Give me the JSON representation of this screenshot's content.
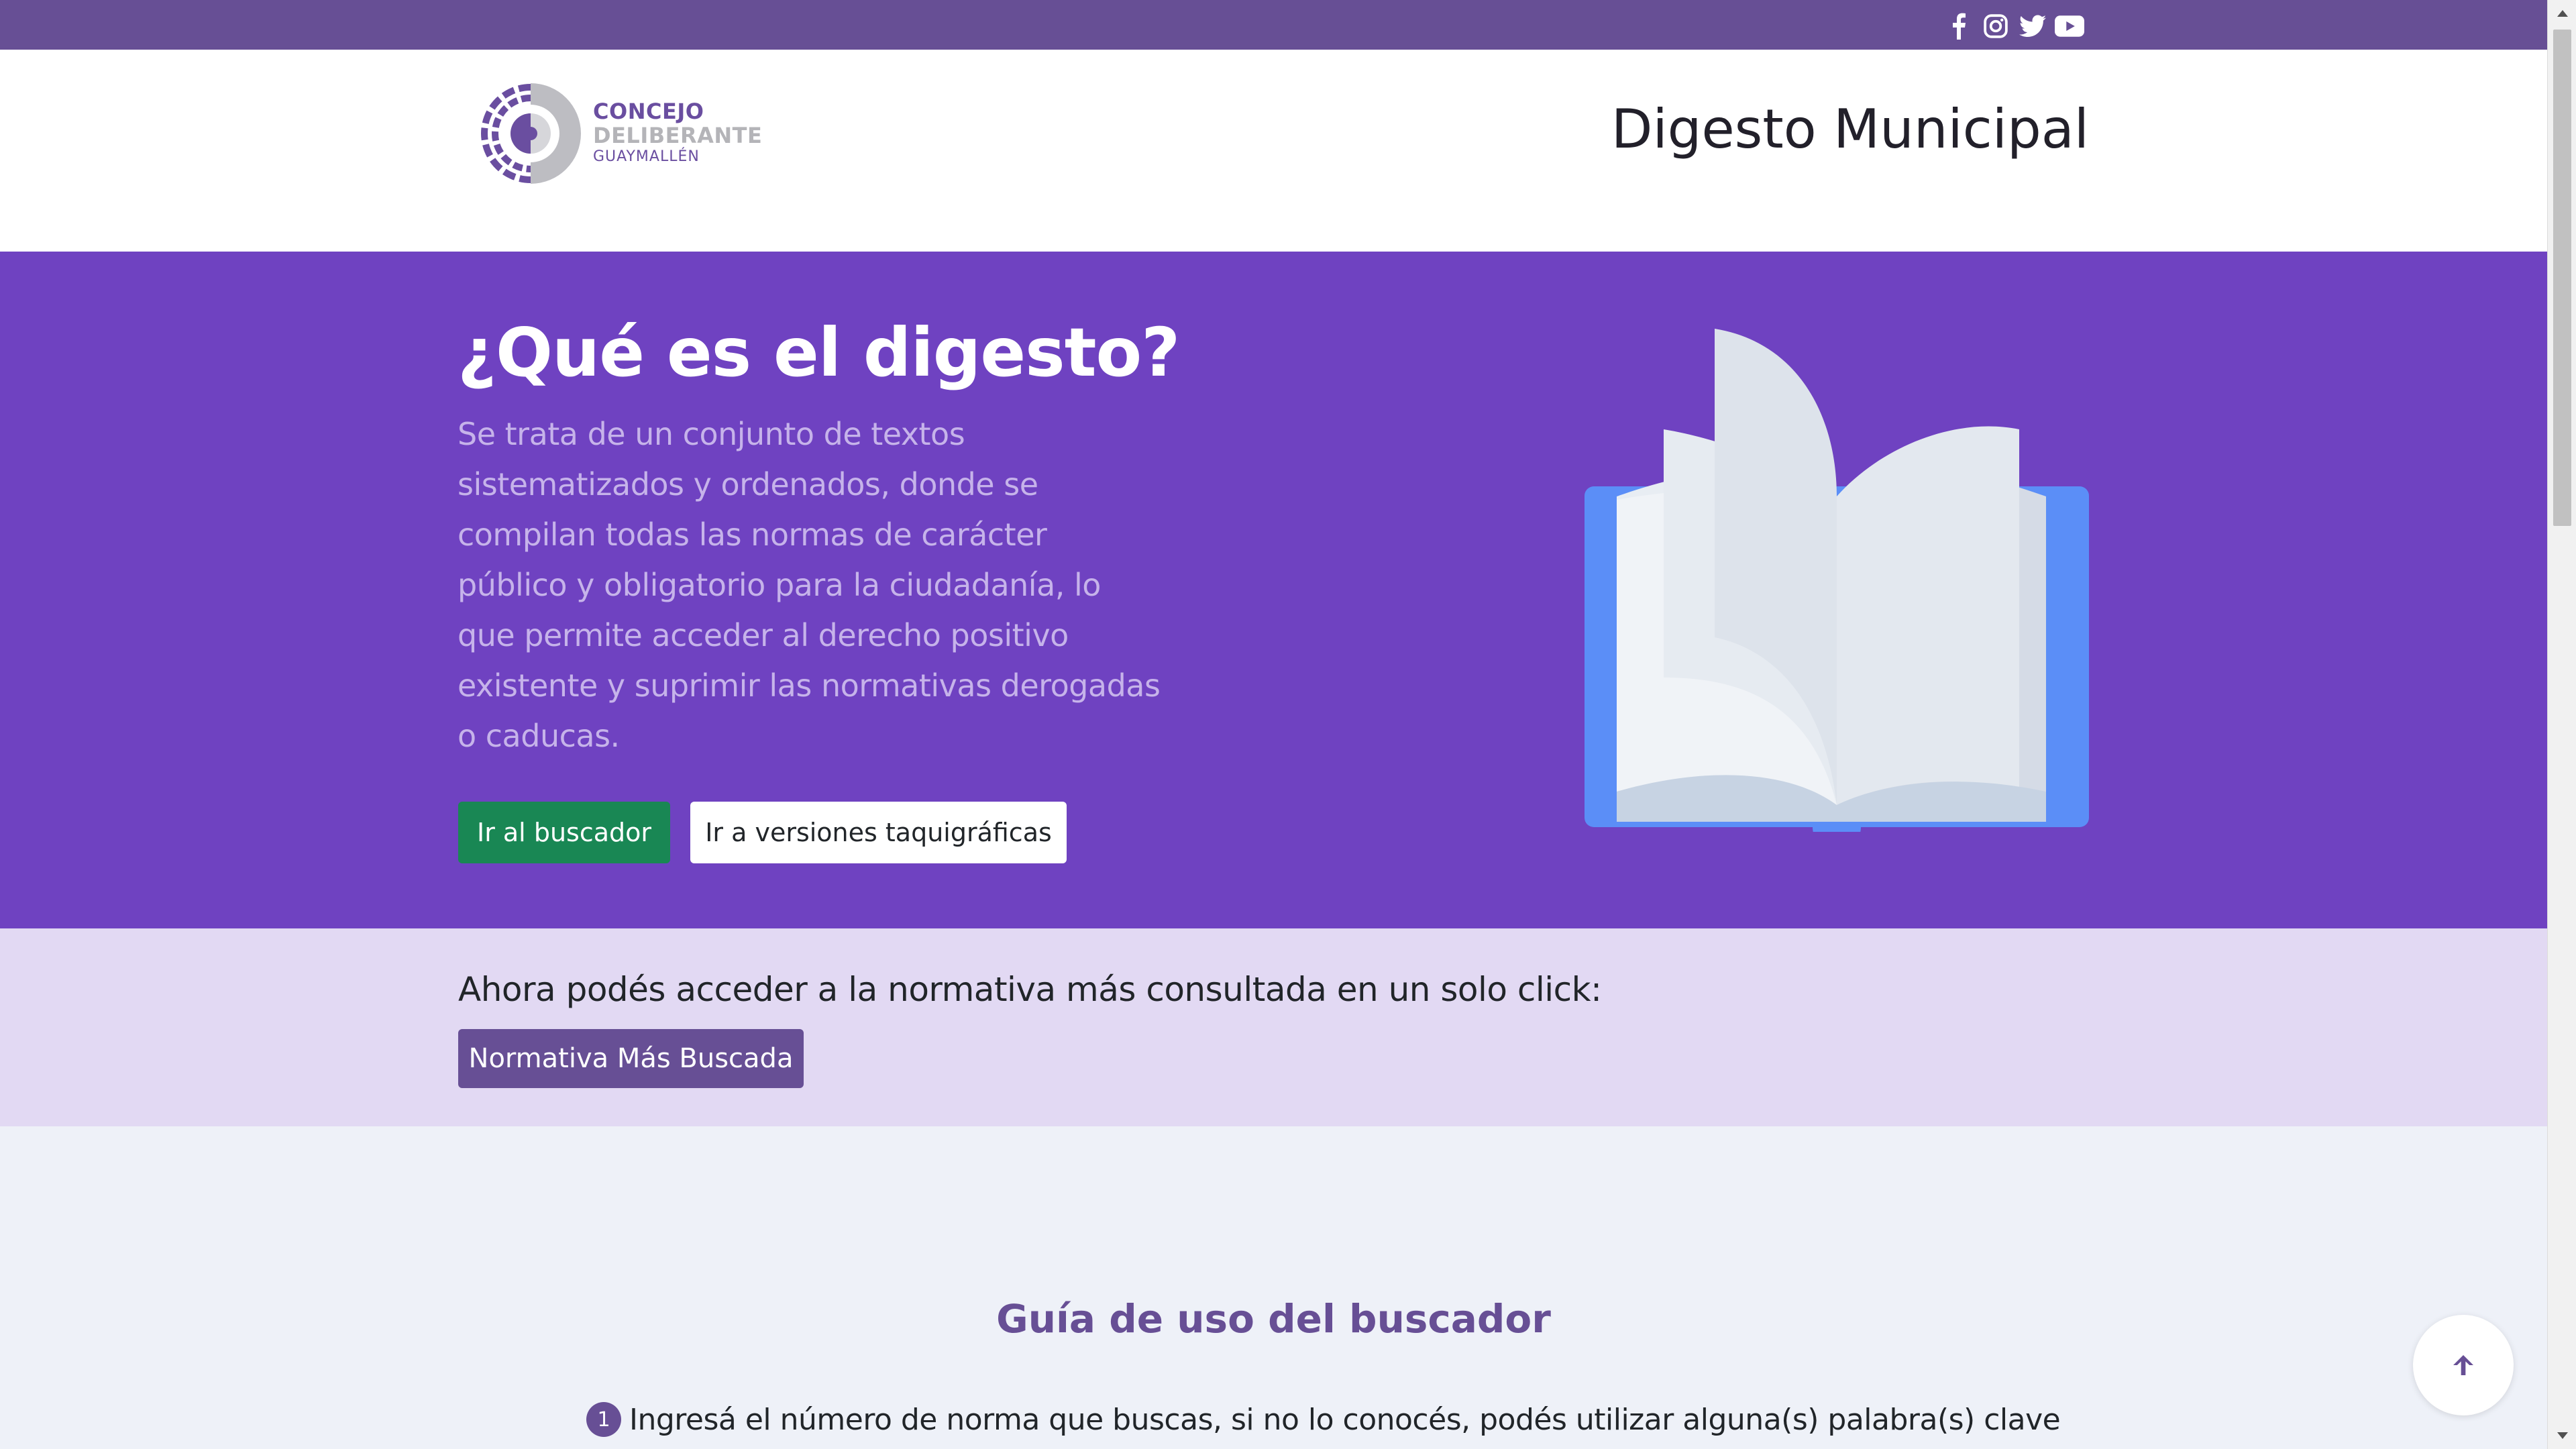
{
  "social": {
    "icons": [
      "facebook-icon",
      "instagram-icon",
      "twitter-icon",
      "youtube-icon"
    ]
  },
  "header": {
    "logo": {
      "line1": "CONCEJO",
      "line2": "DELIBERANTE",
      "line3": "GUAYMALLÉN"
    },
    "title": "Digesto Municipal"
  },
  "hero": {
    "heading": "¿Qué es el digesto?",
    "description": "Se trata de un conjunto de textos sistematizados y ordenados, donde se compilan todas las normas de carácter público y obligatorio para la ciudadanía, lo que permite acceder al derecho positivo existente y suprimir las normativas derogadas o caducas.",
    "primary_button": "Ir al buscador",
    "secondary_button": "Ir a versiones taquigráficas",
    "illustration": "open-book-illustration"
  },
  "promo": {
    "text": "Ahora podés acceder a la normativa más consultada en un solo click:",
    "button": "Normativa Más Buscada"
  },
  "guide": {
    "title": "Guía de uso del buscador",
    "steps": [
      {
        "number": "1",
        "text": "Ingresá el número de norma que buscas, si no lo conocés, podés utilizar alguna(s) palabra(s) clave"
      }
    ]
  },
  "back_to_top_icon": "arrow-up-icon",
  "colors": {
    "topbar": "#674f95",
    "hero": "#6f42c1",
    "hero_text": "#c6b3ea",
    "promo_bg": "#e2d9f3",
    "button_green": "#198754",
    "button_purple": "#674f95",
    "page_bg": "#eef1f8",
    "book_cover": "#5b8ef7"
  }
}
